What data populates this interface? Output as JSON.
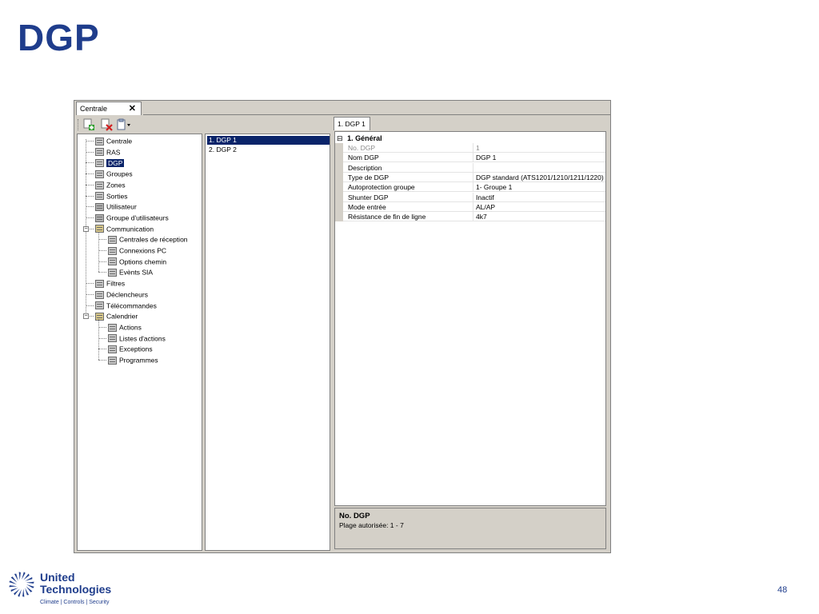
{
  "slide": {
    "title": "DGP",
    "page_number": "48"
  },
  "window": {
    "tab_label": "Centrale",
    "close_glyph": "✕",
    "toolbar": [
      {
        "name": "add-icon"
      },
      {
        "name": "delete-icon"
      },
      {
        "name": "clipboard-dropdown-icon"
      }
    ],
    "tree": [
      {
        "label": "Centrale",
        "level": 0,
        "icon": "panel-icon"
      },
      {
        "label": "RAS",
        "level": 0,
        "icon": "keypad-icon"
      },
      {
        "label": "DGP",
        "level": 0,
        "icon": "dgp-icon",
        "selected": true
      },
      {
        "label": "Groupes",
        "level": 0,
        "icon": "groups-icon"
      },
      {
        "label": "Zones",
        "level": 0,
        "icon": "zones-icon"
      },
      {
        "label": "Sorties",
        "level": 0,
        "icon": "outputs-icon"
      },
      {
        "label": "Utilisateur",
        "level": 0,
        "icon": "user-icon"
      },
      {
        "label": "Groupe d'utilisateurs",
        "level": 0,
        "icon": "user-group-icon"
      },
      {
        "label": "Communication",
        "level": 0,
        "icon": "folder-icon",
        "expanded": true
      },
      {
        "label": "Centrales de réception",
        "level": 1,
        "icon": "receiver-icon"
      },
      {
        "label": "Connexions PC",
        "level": 1,
        "icon": "pc-icon"
      },
      {
        "label": "Options chemin",
        "level": 1,
        "icon": "path-icon"
      },
      {
        "label": "Evènts SIA",
        "level": 1,
        "icon": "sia-icon"
      },
      {
        "label": "Filtres",
        "level": 0,
        "icon": "filter-icon"
      },
      {
        "label": "Déclencheurs",
        "level": 0,
        "icon": "trigger-icon"
      },
      {
        "label": "Télécommandes",
        "level": 0,
        "icon": "remote-icon"
      },
      {
        "label": "Calendrier",
        "level": 0,
        "icon": "folder-icon",
        "expanded": true
      },
      {
        "label": "Actions",
        "level": 1,
        "icon": "actions-icon"
      },
      {
        "label": "Listes d'actions",
        "level": 1,
        "icon": "action-list-icon"
      },
      {
        "label": "Exceptions",
        "level": 1,
        "icon": "exceptions-icon"
      },
      {
        "label": "Programmes",
        "level": 1,
        "icon": "programs-icon"
      }
    ],
    "list": [
      {
        "label": "1. DGP 1",
        "selected": true
      },
      {
        "label": "2. DGP 2",
        "selected": false
      }
    ],
    "detail_tab": "1. DGP 1",
    "category": {
      "expander": "⊟",
      "label": "1. Général"
    },
    "properties": [
      {
        "name": "No. DGP",
        "value": "1",
        "disabled": true
      },
      {
        "name": "Nom DGP",
        "value": "DGP 1"
      },
      {
        "name": "Description",
        "value": ""
      },
      {
        "name": "Type de DGP",
        "value": "DGP standard (ATS1201/1210/1211/1220)"
      },
      {
        "name": "Autoprotection groupe",
        "value": "1- Groupe 1"
      },
      {
        "name": "Shunter DGP",
        "value": "Inactif"
      },
      {
        "name": "Mode entrée",
        "value": "AL/AP"
      },
      {
        "name": "Résistance de fin de ligne",
        "value": "4k7"
      }
    ],
    "description_panel": {
      "title": "No. DGP",
      "text": "Plage autorisée: 1 - 7"
    }
  },
  "logo": {
    "line1": "United",
    "line2": "Technologies",
    "tagline": "Climate | Controls | Security"
  },
  "colors": {
    "brand_blue": "#1f3d8c",
    "selection": "#0a246a",
    "chrome": "#d4d0c8"
  }
}
